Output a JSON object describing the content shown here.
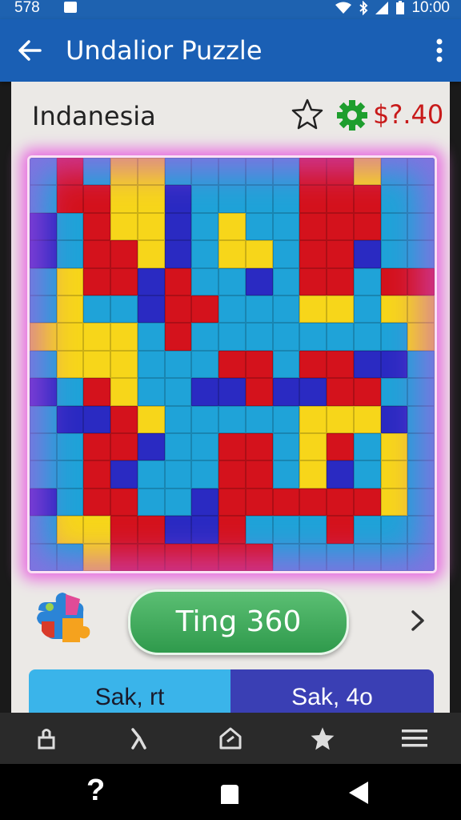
{
  "status_bar": {
    "time_left": "578",
    "time_right": "10:00"
  },
  "app_bar": {
    "title": "Undalior Puzzle"
  },
  "header": {
    "country": "Indanesia",
    "price": "$?.40"
  },
  "board": {
    "colors": {
      "R": "#d4121c",
      "Y": "#f7d61a",
      "C": "#1fa3d8",
      "B": "#2a2ac2"
    },
    "rows": [
      "CRCYYCCCCCRRYCC",
      "CRRYYBCCCCRRRCC",
      "BCRYYBCYCCRRRCC",
      "BCRRYBCYYCRRBCC",
      "CYRRBRCCBCRRCRR",
      "CYCCBRRCCCYYCYY",
      "YYYYCRCCCCCCCCY",
      "CYYYCCCRRCRRBBC",
      "BCRYCCBBRBBRRCC",
      "CBBRYCCCCCYYYBC",
      "CCRRBCCRRCYRCYC",
      "CCRBCCCRRCYBCYC",
      "BCRRCCBRRRRRRYC",
      "CYYRRBBRCCCRCCC",
      "CCYRRRRRRCCCCCC"
    ]
  },
  "action": {
    "button_label": "Ting 360"
  },
  "segments": {
    "left_label": "Sak, rt",
    "right_label": "Sak, 4o"
  },
  "bottom_nav": [
    "lock-icon",
    "person-icon",
    "home-icon",
    "star-icon",
    "menu-icon"
  ],
  "system_nav": {
    "help_label": "?"
  }
}
